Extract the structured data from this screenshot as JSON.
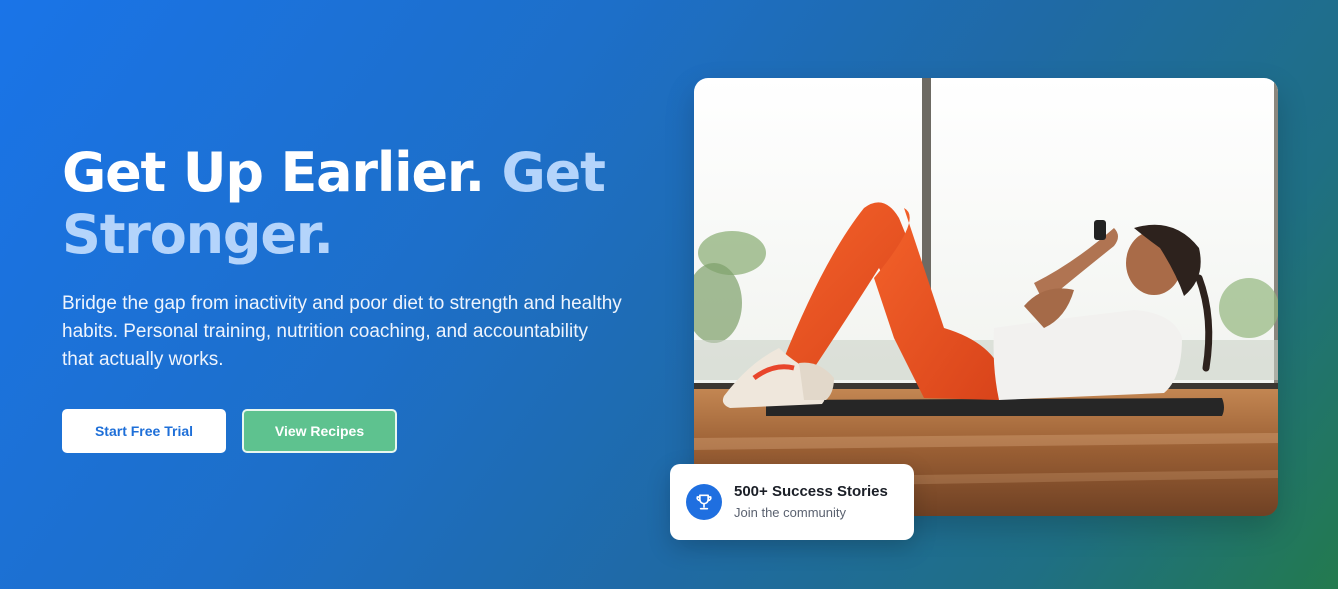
{
  "hero": {
    "headline_part1": "Get Up Earlier.",
    "headline_part2": "Get Stronger.",
    "subtext": "Bridge the gap from inactivity and poor diet to strength and healthy habits. Personal training, nutrition coaching, and accountability that actually works.",
    "primary_button": "Start Free Trial",
    "secondary_button": "View Recipes"
  },
  "image": {
    "alt": "Woman doing crunches on a mat in a bright gym"
  },
  "stats_card": {
    "icon": "trophy-icon",
    "title": "500+ Success Stories",
    "subtitle": "Join the community"
  },
  "colors": {
    "gradient_start": "#1a74e8",
    "gradient_end": "#237a4e",
    "accent_text": "#b4d4fb",
    "primary_button_text": "#1e6fd8",
    "secondary_button_bg": "#5ec28f",
    "trophy_bg": "#1f6fe0"
  }
}
